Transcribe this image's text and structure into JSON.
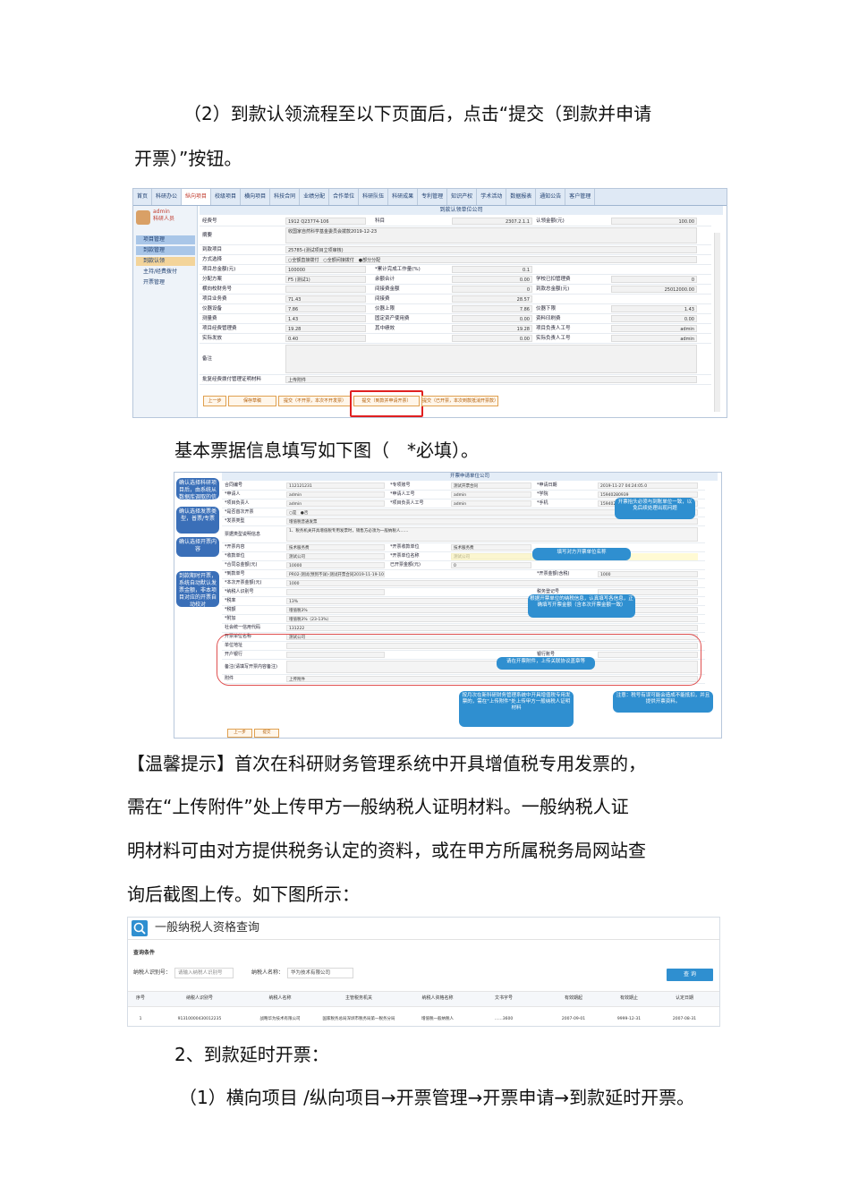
{
  "doc": {
    "p1_line1": "（2）到款认领流程至以下页面后，点击“提交（到款并申请",
    "p1_line2": "开票）”按钮。",
    "p2": "基本票据信息填写如下图（　*必填）。",
    "tip_line1": "【温馨提示】首次在科研财务管理系统中开具增值税专用发票的，",
    "tip_line2": "需在“上传附件”处上传甲方一般纳税人证明材料。一般纳税人证",
    "tip_line3": "明材料可由对方提供税务认定的资料，或在甲方所属税务局网站查",
    "tip_line4": "询后截图上传。如下图所示：",
    "section2": "2、到款延时开票：",
    "section2_1": "（1）横向项目 /纵向项目→开票管理→开票申请→到款延时开票。"
  },
  "shot1": {
    "nav": [
      "首页",
      "科研办公",
      "纵向项目",
      "校级项目",
      "横向项目",
      "科技合同",
      "业绩分配",
      "合作单位",
      "科研队伍",
      "科研成果",
      "专利管理",
      "知识产权",
      "学术活动",
      "数据报表",
      "通知公告",
      "客户管理"
    ],
    "nav_active_index": 2,
    "user_name": "admin",
    "user_role": "科研人员",
    "left_menu": [
      "项目管理",
      "到款管理",
      "到款认领",
      "主持/经费拨付",
      "开票管理"
    ],
    "left_menu_selected_index": 2,
    "form_title": "到款认领单位公司",
    "rows": [
      {
        "label": "经费号",
        "v1": "1912 Q23774-106",
        "label2": "科目",
        "v2": "2307.2.1.1",
        "label3": "认领金额(元)",
        "v3": "100.00"
      },
      {
        "label": "摘要",
        "v1": "收国家自然科学基金委员会拨款2019-12-23"
      },
      {
        "label": "到款项目",
        "v1": "25785-(测试项目立项审核)"
      },
      {
        "label": "方式选择",
        "v1": "○全额直接拨付　○全额间接拨付　●部分分配"
      },
      {
        "label": "项目总金额(元)",
        "v1": "100000",
        "label2": "*累计完成工作量(%)",
        "v2": "0.1"
      },
      {
        "label": "分配方案",
        "v1": "F5 (测试1)",
        "label2": "余额合计",
        "v2": "0.00",
        "label3": "学校已扣管理费",
        "v3": "0"
      },
      {
        "label": "横向校财务号",
        "v1": "",
        "label2": "间接费金额",
        "v2": "0",
        "label3": "到款总金额(元)",
        "v3": "25012000.00"
      },
      {
        "label": "项目业务费",
        "v1": "71.43",
        "label2": "间接费",
        "v2": "28.57"
      },
      {
        "label": "仪器设备",
        "v1": "7.86",
        "label2": "仪器上限",
        "v2": "7.86",
        "label3": "仪器下限",
        "v3": "1.43"
      },
      {
        "label": "测量费",
        "v1": "1.43",
        "label2": "固定资产使用费",
        "v2": "0.00",
        "label3": "资料印刷费",
        "v3": "0.00"
      },
      {
        "label": "项目经费管理费",
        "v1": "19.28",
        "label2": "其中绩效",
        "v2": "19.28",
        "label3": "项目负责人工号",
        "v3": "admin"
      },
      {
        "label": "实际发放",
        "v1": "0.40",
        "label2": "",
        "v2": "0.00",
        "label3": "实际负责人工号",
        "v3": "admin"
      },
      {
        "label": "备注",
        "v1": ""
      },
      {
        "label": "批复经费拨付管理证明材料",
        "v1": "上传附件"
      }
    ],
    "buttons": [
      "上一步",
      "保存草稿",
      "提交（不开票，本次不开发票）",
      "提交（到款并申请开票）",
      "提交（已开票，本次到款抵消开票款）"
    ],
    "highlight_button_index": 3
  },
  "shot2": {
    "form_title": "开票申请单位公司",
    "callouts_left": [
      "确认选择科研项目后，由系统从数据库调取的信息",
      "确认选择发票类型，普票/专票",
      "确认选择开票内容",
      "到款期时开票，系统自动默认发票金额，非本项目对应的开票自动校对"
    ],
    "callouts_right": [
      "开票抬头必须与到账单位一致，以免后续处理出现问题",
      "填写对方开票单位名称",
      "根据开票单位的纳税信息，认真填写各信息，正确填写开票金额（含本次开票金额一致）",
      "请在开票附件，上传关联协议盖章等",
      "按月次在新科研财务管理系统中开具增值税专用发票的，需在\"上传附件\"处上传甲方一般纳税人证明材料",
      "注意：税号有误可能会造成不能抵扣，并且提供开票资料。"
    ],
    "rows": [
      {
        "label": "合同编号",
        "v1": "112121231",
        "label2": "*专项账号",
        "v2": "测试开票合同",
        "label3": "*申请日期",
        "v3": "2019-11-27 04:24:05.0"
      },
      {
        "label": "*申请人",
        "v1": "admin",
        "label2": "*申请人工号",
        "v2": "admin",
        "label3": "*学院",
        "v3": "15940280939"
      },
      {
        "label": "*项目负责人",
        "v1": "admin",
        "label2": "*项目负责人工号",
        "v2": "admin",
        "label3": "*手机",
        "v3": "15940280939"
      },
      {
        "label": "*是否首次开票",
        "v1": "○是　●否"
      },
      {
        "label": "*发票类型",
        "v1": "增值税普通发票"
      },
      {
        "label": "票据类型说明信息",
        "v1": "1、税务机关开具增值税专用发票时，销售方必须为一般纳税人……"
      },
      {
        "label": "*开票内容",
        "v1": "技术服务费",
        "label2": "*开票收款单位",
        "v2": "技术服务费"
      },
      {
        "label": "*收款单位",
        "v1": "测试公司",
        "label2": "*开票单位名称",
        "v2": "测试公司"
      },
      {
        "label": "*合同总金额(元)",
        "v1": "10000",
        "label2": "已开票金额(元)",
        "v2": "0"
      },
      {
        "label": "*到款单号",
        "v1": "PR02-测试(预到不详)-测试开票合同2019-11-19-1000",
        "label3": "*开票金额(含税)",
        "v3": "1000"
      },
      {
        "label": "*本次开票金额(元)",
        "v1": "1000"
      },
      {
        "label": "*纳税人识别号",
        "v1": "",
        "label3": "税务登记号",
        "v3": ""
      },
      {
        "label": "*税率",
        "v1": "13%"
      },
      {
        "label": "*税额",
        "v1": "增值税3%"
      },
      {
        "label": "*附加",
        "v1": "增值税3%（23-13%）"
      },
      {
        "label": "社会统一信用代码",
        "v1": "131222"
      },
      {
        "label": "开票单位名称",
        "v1": "测试公司"
      },
      {
        "label": "单位地址",
        "v1": ""
      },
      {
        "label": "开户银行",
        "v1": "",
        "label3": "银行账号",
        "v3": ""
      },
      {
        "label": "备注(请填写开票内容备注)",
        "v1": ""
      },
      {
        "label": "附件",
        "v1": "上传附件"
      }
    ],
    "buttons": [
      "上一步",
      "提交"
    ]
  },
  "shot3": {
    "title": "一般纳税人资格查询",
    "cond_label": "查询条件",
    "field1_label": "纳税人识别号：",
    "field1_placeholder": "请输入纳税人识别号",
    "field2_label": "纳税人名称：",
    "field2_value": "华为技术有限公司",
    "search_btn": "查 询",
    "headers": [
      "序号",
      "纳税人识别号",
      "纳税人名称",
      "主管税务机关",
      "纳税人资格名称",
      "文书字号",
      "有效期起",
      "有效期止",
      "认定日期"
    ],
    "row": [
      "1",
      "91310000430012235",
      "战略华为技术有限公司",
      "国家税务总局深圳市税务局第一税务分局",
      "增值税一般纳税人",
      "……3600",
      "2007-09-01",
      "9999-12-31",
      "2007-08-31"
    ]
  },
  "colors": {
    "accent": "#2f8fd0",
    "highlight_red": "#e02020",
    "callout_blue": "#3a6fb8"
  }
}
